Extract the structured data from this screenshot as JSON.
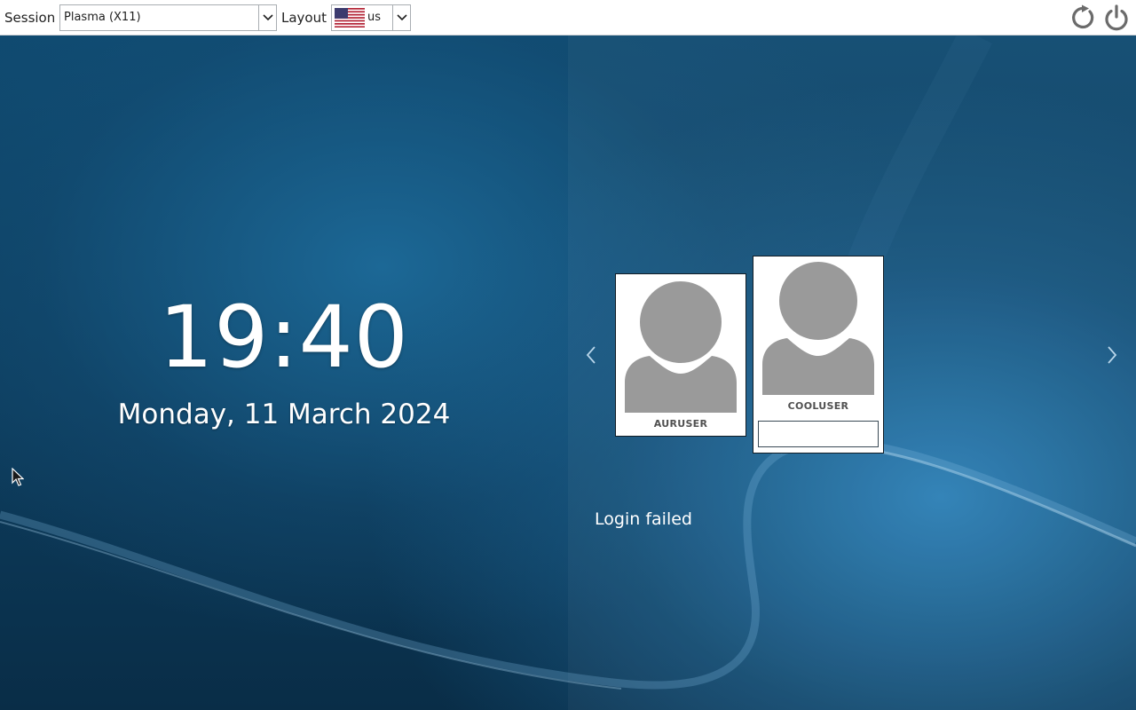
{
  "topbar": {
    "session_label": "Session",
    "session_value": "Plasma (X11)",
    "layout_label": "Layout",
    "layout_value": "us",
    "layout_flag": "us-flag-icon",
    "actions": [
      "restart-icon",
      "shutdown-icon"
    ]
  },
  "clock": {
    "time": "19:40",
    "date": "Monday, 11 March 2024"
  },
  "users": [
    {
      "name": "AURUSER",
      "avatar": "default-user-icon",
      "selected": false
    },
    {
      "name": "COOLUSER",
      "avatar": "default-user-icon",
      "selected": true
    }
  ],
  "password": {
    "value": "",
    "placeholder": ""
  },
  "status": {
    "message": "Login failed"
  },
  "colors": {
    "background": "#11466a",
    "highlight": "#2d80b6",
    "avatar_gray": "#9a9a9a",
    "username_gray": "#505050"
  }
}
